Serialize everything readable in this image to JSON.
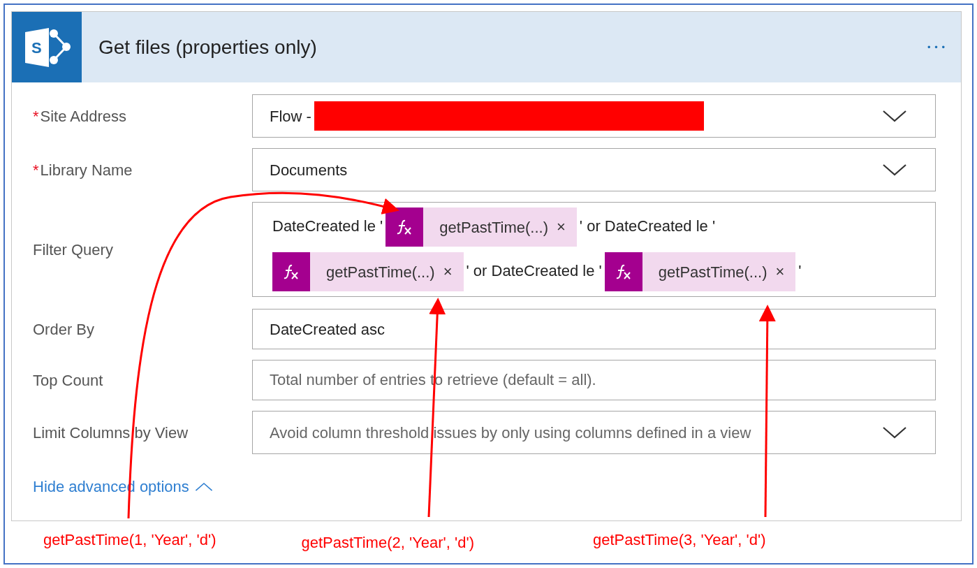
{
  "card": {
    "logo_letter": "S",
    "required_mark": "*",
    "title": "Get files (properties only)",
    "menu": "• • •",
    "fields": [
      {
        "label": "Site Address",
        "required": true,
        "kind": "dropdown",
        "value": "Flow -",
        "redacted": true
      },
      {
        "label": "Library Name",
        "required": true,
        "kind": "dropdown",
        "value": "Documents",
        "redacted": false
      },
      {
        "label": "Filter Query",
        "required": false,
        "kind": "expression",
        "lines": [
          [
            {
              "kind": "text",
              "text": "DateCreated le '"
            },
            {
              "kind": "token",
              "text": "getPastTime(...)",
              "close": "×"
            },
            {
              "kind": "text",
              "text": "' or DateCreated le '"
            }
          ],
          [
            {
              "kind": "token",
              "text": "getPastTime(...)",
              "close": "×"
            },
            {
              "kind": "text",
              "text": "' or DateCreated le '"
            },
            {
              "kind": "token",
              "text": "getPastTime(...)",
              "close": "×"
            },
            {
              "kind": "text",
              "text": "'"
            }
          ]
        ]
      },
      {
        "label": "Order By",
        "required": false,
        "kind": "text",
        "value": "DateCreated asc"
      },
      {
        "label": "Top Count",
        "required": false,
        "kind": "text",
        "placeholder": "Total number of entries to retrieve (default = all)."
      },
      {
        "label": "Limit Columns by View",
        "required": false,
        "kind": "dropdown",
        "placeholder": "Avoid column threshold issues by only using columns defined in a view",
        "redacted": false
      }
    ],
    "advanced_link": "Hide advanced options"
  },
  "annotations": [
    "getPastTime(1, 'Year', 'd')",
    "getPastTime(2, 'Year', 'd')",
    "getPastTime(3, 'Year', 'd')"
  ]
}
